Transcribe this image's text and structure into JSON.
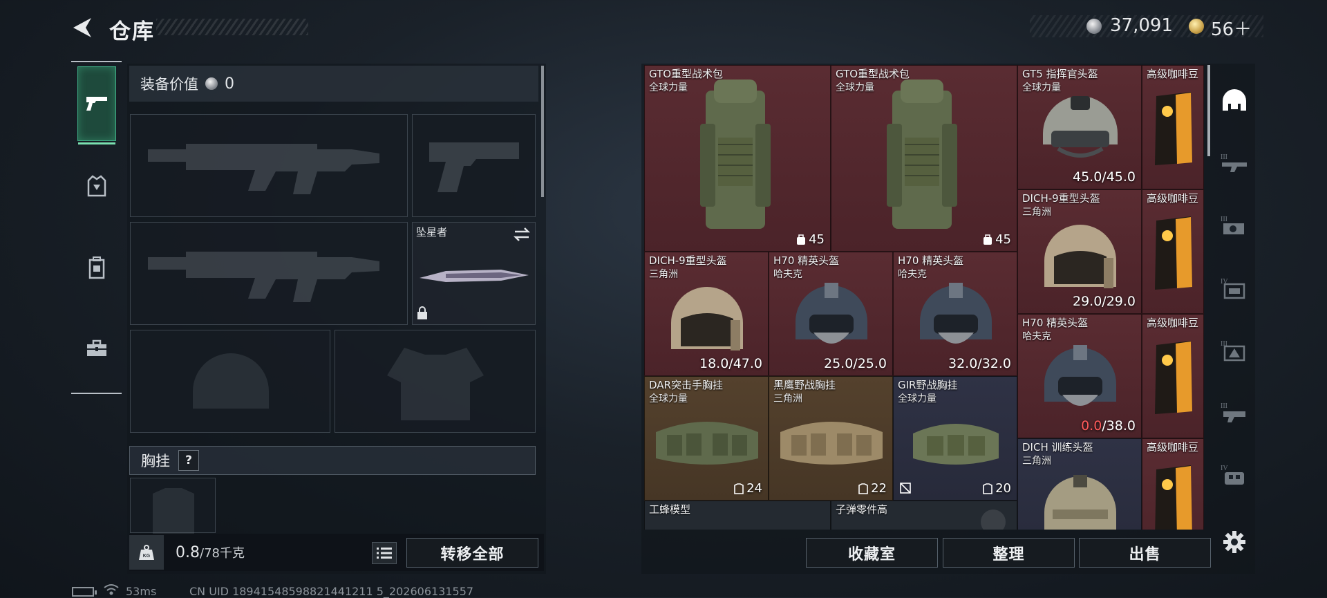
{
  "header": {
    "title": "仓库"
  },
  "currency": {
    "silver": "37,091",
    "gold": "56＋"
  },
  "side_tabs": [
    {
      "name": "weapons",
      "icon": "pistol-icon"
    },
    {
      "name": "armor",
      "icon": "vest-icon"
    },
    {
      "name": "backpack",
      "icon": "backpack-icon"
    },
    {
      "name": "tools",
      "icon": "toolbox-icon"
    }
  ],
  "equipment": {
    "value_label": "装备价值",
    "value": "0",
    "melee_name": "坠星者",
    "chest_rig_label": "胸挂",
    "help": "?",
    "weight_current": "0.8",
    "weight_max": "/78千克",
    "transfer_all": "转移全部"
  },
  "stash": {
    "items": [
      {
        "name": "GTO重型战术包",
        "sub": "全球力量",
        "cap": "45"
      },
      {
        "name": "GTO重型战术包",
        "sub": "全球力量",
        "cap": "45"
      },
      {
        "name": "GT5 指挥官头盔",
        "sub": "全球力量",
        "dur": "45.0/45.0"
      },
      {
        "name": "高级咖啡豆"
      },
      {
        "name": "DICH-9重型头盔",
        "sub": "三角洲",
        "dur": "29.0/29.0"
      },
      {
        "name": "高级咖啡豆"
      },
      {
        "name": "DICH-9重型头盔",
        "sub": "三角洲",
        "dur": "18.0/47.0"
      },
      {
        "name": "H70 精英头盔",
        "sub": "哈夫克",
        "dur": "25.0/25.0"
      },
      {
        "name": "H70 精英头盔",
        "sub": "哈夫克",
        "dur": "32.0/32.0"
      },
      {
        "name": "H70 精英头盔",
        "sub": "哈夫克",
        "dur_cur": "0.0",
        "dur_max": "/38.0"
      },
      {
        "name": "高级咖啡豆"
      },
      {
        "name": "DAR突击手胸挂",
        "sub": "全球力量",
        "cap": "24"
      },
      {
        "name": "黑鹰野战胸挂",
        "sub": "三角洲",
        "cap": "22"
      },
      {
        "name": "GIR野战胸挂",
        "sub": "全球力量",
        "cap": "20"
      },
      {
        "name": "DICH 训练头盔",
        "sub": "三角洲"
      },
      {
        "name": "高级咖啡豆"
      },
      {
        "name": "工蜂模型"
      },
      {
        "name": "子弹零件高"
      }
    ]
  },
  "actions": {
    "collection": "收藏室",
    "sort": "整理",
    "sell": "出售"
  },
  "right_rail": [
    "helmet-filter-icon",
    "tier3-gun-icon",
    "tier3-grenade-icon",
    "tier4-box-icon",
    "tier3-triangle-icon",
    "tier3-equip-icon",
    "tier4-chest-icon"
  ],
  "status": {
    "ping": "53ms",
    "uid": "CN UID 18941548598821441211 5_202606131557"
  }
}
